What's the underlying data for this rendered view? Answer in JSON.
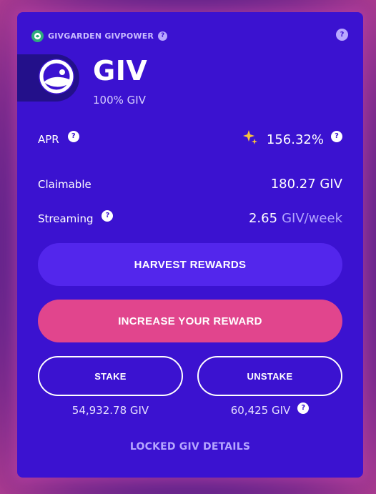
{
  "header": {
    "label": "GIVGARDEN GIVPOWER",
    "icon": "givgarden-logo-icon",
    "help_symbol": "?",
    "corner_help_symbol": "?"
  },
  "token": {
    "icon": "giv-token-icon",
    "name": "GIV",
    "composition": "100% GIV"
  },
  "stats": {
    "apr_label": "APR",
    "apr_value": "156.32%",
    "apr_icon": "sparkle-icon",
    "claimable_label": "Claimable",
    "claimable_value": "180.27 GIV",
    "streaming_label": "Streaming",
    "streaming_amount": "2.65",
    "streaming_unit": "GIV/week",
    "help_symbol": "?"
  },
  "actions": {
    "harvest_label": "HARVEST REWARDS",
    "increase_label": "INCREASE YOUR REWARD",
    "stake_label": "STAKE",
    "unstake_label": "UNSTAKE",
    "stake_amount": "54,932.78 GIV",
    "unstake_amount": "60,425 GIV",
    "locked_details_label": "LOCKED GIV DETAILS"
  },
  "colors": {
    "card_bg": "#3b12d0",
    "harvest_bg": "#5326ec",
    "increase_bg": "#e1458d",
    "muted_text": "#b3a6ff"
  }
}
